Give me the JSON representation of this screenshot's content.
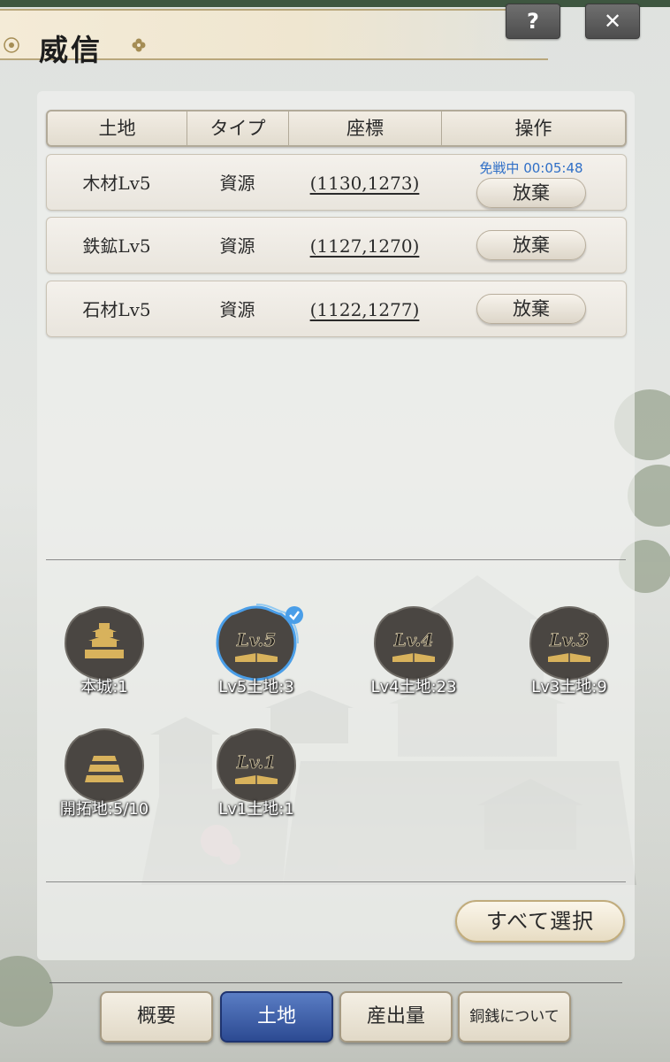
{
  "header": {
    "title": "威信",
    "help_label": "?",
    "close_label": "✕"
  },
  "table": {
    "columns": [
      "土地",
      "タイプ",
      "座標",
      "操作"
    ],
    "rows": [
      {
        "land": "木材Lv5",
        "type": "資源",
        "coords": "(1130,1273)",
        "status": "免戦中 00:05:48",
        "action": "放棄"
      },
      {
        "land": "鉄鉱Lv5",
        "type": "資源",
        "coords": "(1127,1270)",
        "action": "放棄"
      },
      {
        "land": "石材Lv5",
        "type": "資源",
        "coords": "(1122,1277)",
        "action": "放棄"
      }
    ]
  },
  "land_filters": [
    {
      "label": "本城:1",
      "icon": "castle-icon",
      "badge": "",
      "selected": false
    },
    {
      "label": "Lv5土地:3",
      "icon": "land-level-icon",
      "badge": "Lv.5",
      "selected": true
    },
    {
      "label": "Lv4土地:23",
      "icon": "land-level-icon",
      "badge": "Lv.4",
      "selected": false
    },
    {
      "label": "Lv3土地:9",
      "icon": "land-level-icon",
      "badge": "Lv.3",
      "selected": false
    },
    {
      "label": "開拓地:5/10",
      "icon": "developed-land-icon",
      "badge": "",
      "selected": false
    },
    {
      "label": "Lv1土地:1",
      "icon": "land-level-icon",
      "badge": "Lv.1",
      "selected": false
    }
  ],
  "select_all_label": "すべて選択",
  "tabs": [
    {
      "label": "概要",
      "active": false
    },
    {
      "label": "土地",
      "active": true
    },
    {
      "label": "産出量",
      "active": false
    },
    {
      "label": "銅銭について",
      "active": false
    }
  ],
  "colors": {
    "accent_blue": "#2c4a92",
    "status_blue": "#2f6fc7",
    "selected_ring": "#4a9ee8",
    "gold": "#d8b25c"
  }
}
